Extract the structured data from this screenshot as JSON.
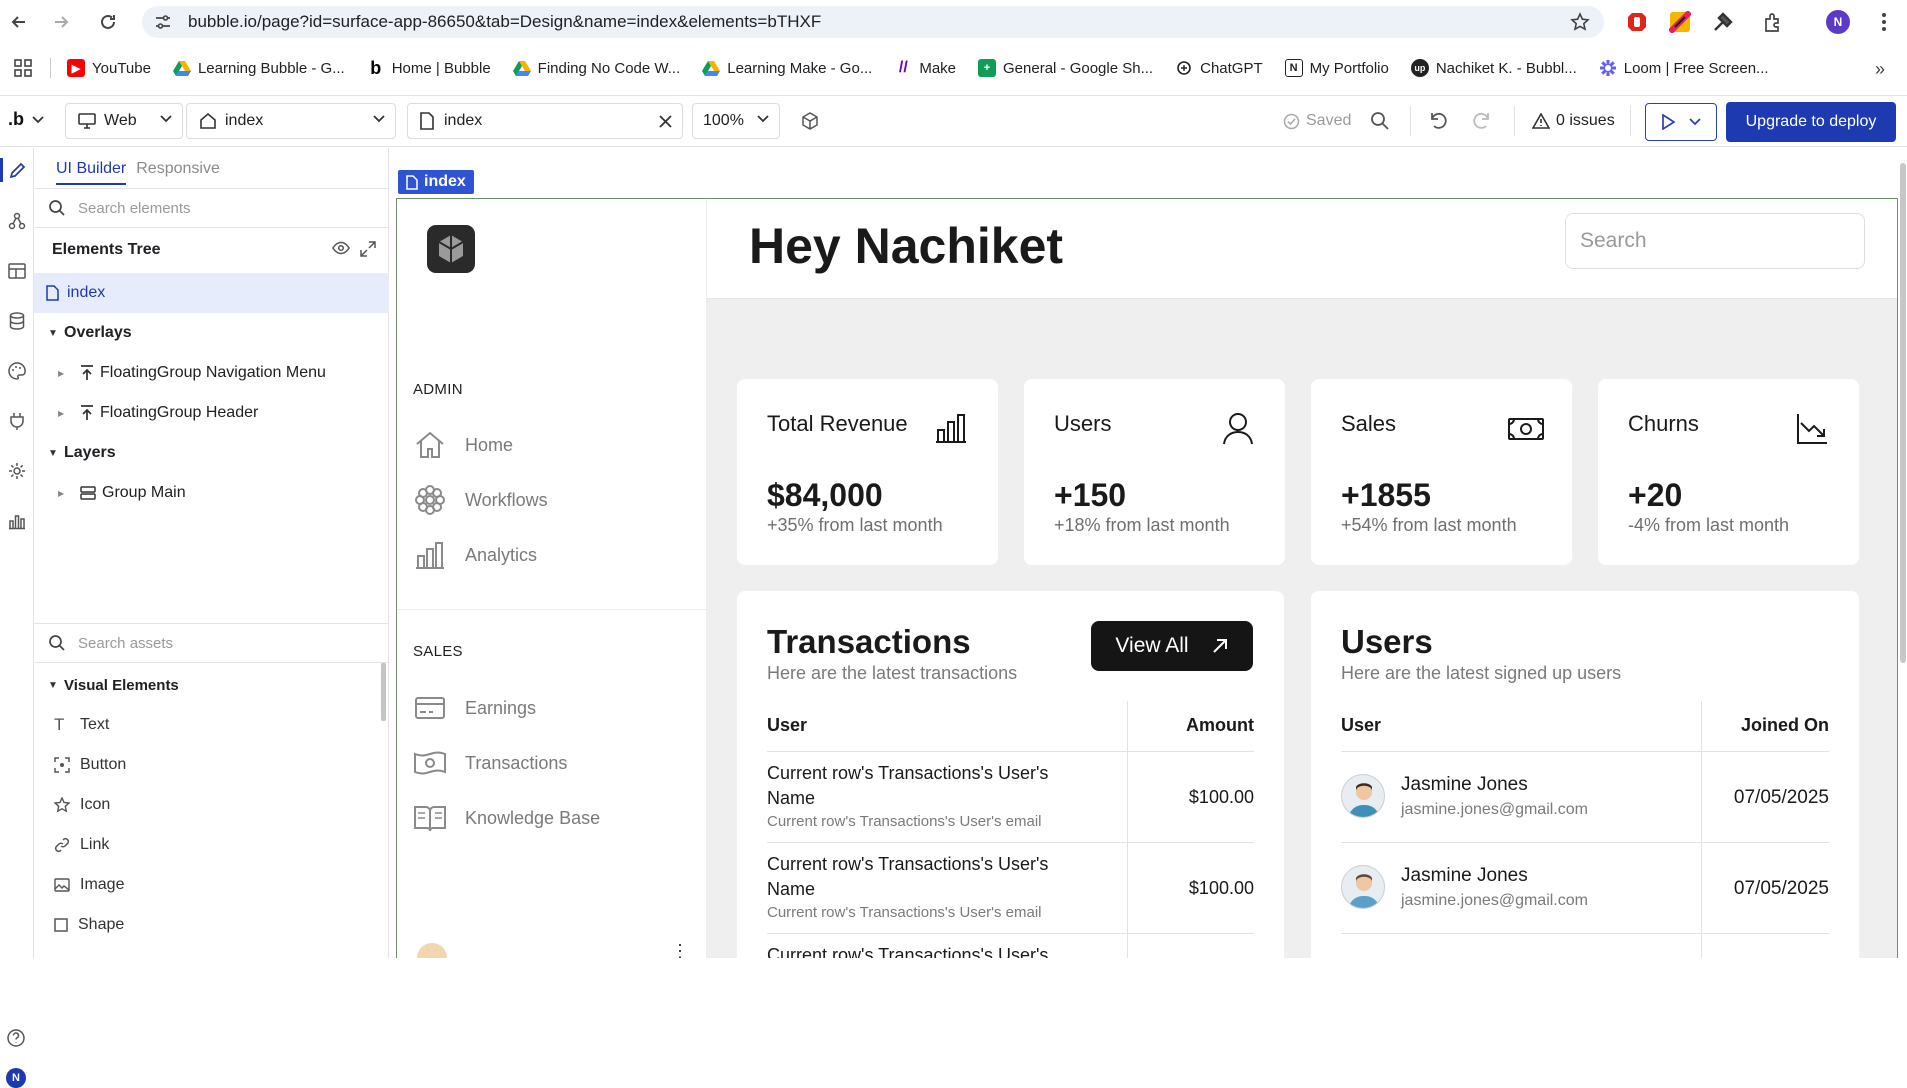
{
  "browser": {
    "url": "bubble.io/page?id=surface-app-86650&tab=Design&name=index&elements=bTHXF",
    "profile_initial": "N",
    "bookmarks": [
      {
        "label": "YouTube",
        "icon": "youtube-icon",
        "color": "#ff0000"
      },
      {
        "label": "Learning Bubble - G...",
        "icon": "google-drive-icon",
        "color": "#f4b400"
      },
      {
        "label": "Home | Bubble",
        "icon": "bubble-icon",
        "color": "#000000"
      },
      {
        "label": "Finding No Code W...",
        "icon": "google-drive-icon",
        "color": "#f4b400"
      },
      {
        "label": "Learning Make - Go...",
        "icon": "google-drive-icon",
        "color": "#f4b400"
      },
      {
        "label": "Make",
        "icon": "make-icon",
        "color": "#6d00cc"
      },
      {
        "label": "General - Google Sh...",
        "icon": "google-sheets-icon",
        "color": "#0f9d58"
      },
      {
        "label": "ChatGPT",
        "icon": "chatgpt-icon",
        "color": "#222222"
      },
      {
        "label": "My Portfolio",
        "icon": "notion-icon",
        "color": "#222222"
      },
      {
        "label": "Nachiket K. - Bubbl...",
        "icon": "upwork-icon",
        "color": "#222222"
      },
      {
        "label": "Loom | Free Screen...",
        "icon": "loom-icon",
        "color": "#625df5"
      }
    ]
  },
  "editor": {
    "logo": ".b",
    "platform": "Web",
    "page_select": "index",
    "element_select": "index",
    "zoom": "100%",
    "saved_label": "Saved",
    "issues_label": "0 issues",
    "deploy_label": "Upgrade to deploy",
    "accent": "#1d3ab0"
  },
  "panel": {
    "tabs": [
      "UI Builder",
      "Responsive"
    ],
    "search_elements_placeholder": "Search elements",
    "tree_title": "Elements Tree",
    "tree": {
      "root": "index",
      "overlays_label": "Overlays",
      "overlays": [
        "FloatingGroup Navigation Menu",
        "FloatingGroup Header"
      ],
      "layers_label": "Layers",
      "layers": [
        "Group Main"
      ]
    },
    "search_assets_placeholder": "Search assets",
    "visual_elements_label": "Visual Elements",
    "visual_elements": [
      "Text",
      "Button",
      "Icon",
      "Link",
      "Image",
      "Shape"
    ]
  },
  "canvas": {
    "page_tag": "index",
    "sidebar": {
      "admin_label": "ADMIN",
      "admin_items": [
        "Home",
        "Workflows",
        "Analytics"
      ],
      "sales_label": "SALES",
      "sales_items": [
        "Earnings",
        "Transactions",
        "Knowledge Base"
      ]
    },
    "header": {
      "greeting": "Hey Nachiket",
      "search_placeholder": "Search"
    },
    "stats": [
      {
        "title": "Total Revenue",
        "value": "$84,000",
        "delta": "+35% from last month",
        "icon": "bar-chart-icon"
      },
      {
        "title": "Users",
        "value": "+150",
        "delta": "+18% from last month",
        "icon": "user-icon"
      },
      {
        "title": "Sales",
        "value": "+1855",
        "delta": "+54% from last month",
        "icon": "banknote-icon"
      },
      {
        "title": "Churns",
        "value": "+20",
        "delta": "-4% from last month",
        "icon": "trending-down-icon"
      }
    ],
    "transactions": {
      "title": "Transactions",
      "subtitle": "Here are the latest transactions",
      "view_all": "View All",
      "col_user": "User",
      "col_amount": "Amount",
      "rows": [
        {
          "name": "Current row's Transactions's User's Name",
          "email": "Current row's Transactions's User's email",
          "amount": "$100.00"
        },
        {
          "name": "Current row's Transactions's User's Name",
          "email": "Current row's Transactions's User's email",
          "amount": "$100.00"
        },
        {
          "name": "Current row's Transactions's User's",
          "email": "",
          "amount": ""
        }
      ]
    },
    "users": {
      "title": "Users",
      "subtitle": "Here are the latest signed up users",
      "col_user": "User",
      "col_joined": "Joined On",
      "rows": [
        {
          "name": "Jasmine Jones",
          "email": "jasmine.jones@gmail.com",
          "joined": "07/05/2025"
        },
        {
          "name": "Jasmine Jones",
          "email": "jasmine.jones@gmail.com",
          "joined": "07/05/2025"
        }
      ]
    }
  }
}
